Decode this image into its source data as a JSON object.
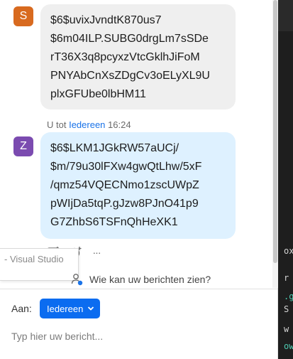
{
  "background_window": {
    "fragments": [
      "ox",
      "r",
      ".g",
      "S",
      "w",
      "ow"
    ]
  },
  "messages": [
    {
      "avatar_letter": "S",
      "avatar_color": "#d86a1f",
      "bubble_color": "#efefef",
      "lines": [
        "$6$uvixJvndtK870us7",
        "$6m04ILP.SUBG0drgLm7sSDe",
        "rT36X3q8pcyxzVtcGklhJiFoM",
        "PNYAbCnXsZDgCv3oELyXL9U",
        "plxGFUbe0lbHM11"
      ]
    },
    {
      "meta": {
        "prefix": "U tot",
        "recipient": "Iedereen",
        "time": "16:24"
      },
      "avatar_letter": "Z",
      "avatar_color": "#7b4bb0",
      "bubble_color": "#def1ff",
      "lines": [
        "$6$LKM1JGkRW57aUCj/",
        "$m/79u30lFXw4gwQtLhw/5xF",
        "/qmz54VQECNmo1zscUWpZ",
        "pWIjDa5tqP.gJzw8PJnO41p9",
        "G7ZhbS6TSFnQhHeXK1"
      ]
    }
  ],
  "message_actions": {
    "icons": [
      "reply-icon",
      "add-reaction-icon",
      "more-icon"
    ],
    "more_label": "···"
  },
  "taskbar_tooltip": {
    "text": "- Visual Studio"
  },
  "privacy": {
    "label": "Wie kan uw berichten zien?"
  },
  "composer": {
    "to_label": "Aan:",
    "recipient_button": "Iedereen",
    "placeholder": "Typ hier uw bericht..."
  },
  "colors": {
    "accent": "#0b6cf0",
    "link": "#1a73e8"
  }
}
